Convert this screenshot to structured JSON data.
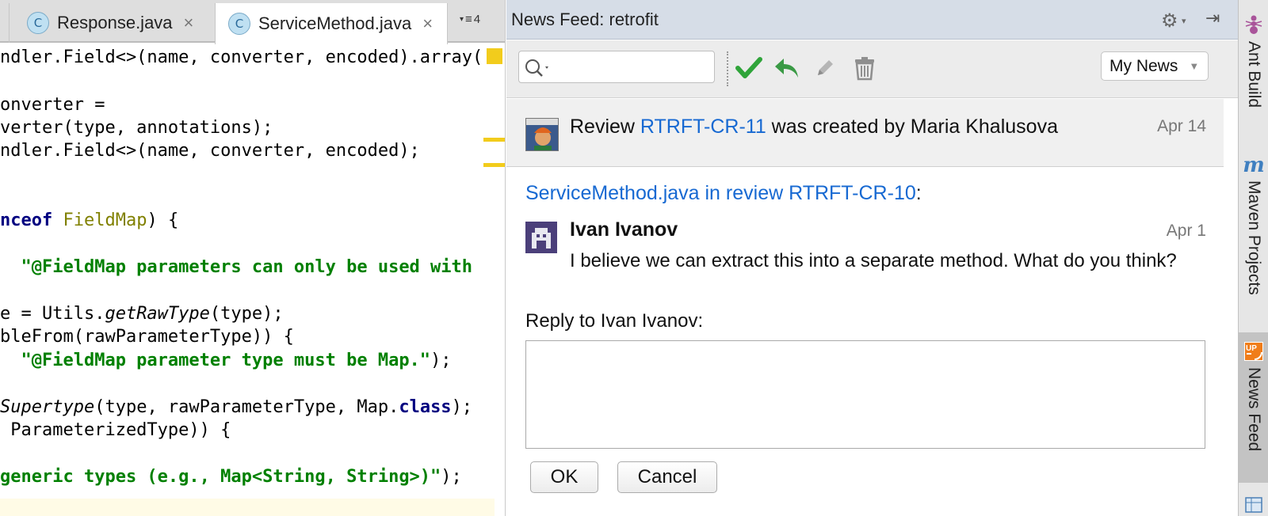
{
  "editor": {
    "tabs": [
      {
        "label": "Response.java",
        "icon": "java-class-icon",
        "close": "×"
      },
      {
        "label": "ServiceMethod.java",
        "icon": "java-class-icon",
        "close": "×",
        "active": true
      }
    ],
    "overflow_count": "4",
    "code_lines": [
      [
        "ndler.Field<>(name, converter, encoded).array("
      ],
      [
        "onverter ="
      ],
      [
        "verter(type, annotations);"
      ],
      [
        "ndler.Field<>(name, converter, encoded);"
      ],
      [
        "nceof",
        " FieldMap",
        ") {"
      ],
      [
        "  \"@FieldMap parameters can only be used with "
      ],
      [
        "e = Utils.",
        "getRawType",
        "(type);"
      ],
      [
        "bleFrom(rawParameterType)) {"
      ],
      [
        "  \"@FieldMap parameter type must be Map.\"",
        ");"
      ],
      [
        "Supertype",
        "(type, rawParameterType, Map.",
        "class",
        ");"
      ],
      [
        " ParameterizedType)) {"
      ],
      [
        "generic types (e.g., Map<String, String>)\"",
        ");"
      ]
    ]
  },
  "panel": {
    "title": "News Feed: retrofit",
    "filter": "My News",
    "search": {
      "value": "",
      "placeholder": ""
    },
    "feed_item": {
      "prefix": "Review ",
      "review_id": "RTRFT-CR-11",
      "suffix": " was created by Maria Khalusova",
      "date": "Apr 14"
    },
    "detail": {
      "title_link": "ServiceMethod.java in review RTRFT-CR-10",
      "title_colon": ":",
      "comment": {
        "author": "Ivan Ivanov",
        "date": "Apr 1",
        "text": "I believe we can extract this into a separate method. What do you think?"
      },
      "reply_label": "Reply to Ivan Ivanov:",
      "reply_value": "",
      "ok_label": "OK",
      "cancel_label": "Cancel"
    }
  },
  "right_strip": {
    "tabs": [
      {
        "label": "Ant Build",
        "icon": "ant-icon"
      },
      {
        "label": "Maven Projects",
        "icon": "maven-icon"
      },
      {
        "label": "News Feed",
        "icon": "upsource-icon",
        "active": true
      }
    ]
  },
  "colors": {
    "link": "#1769d2",
    "keyword": "#000080",
    "string": "#008000",
    "type": "#808000",
    "approve": "#2fa43a",
    "header": "#d6dde7"
  }
}
